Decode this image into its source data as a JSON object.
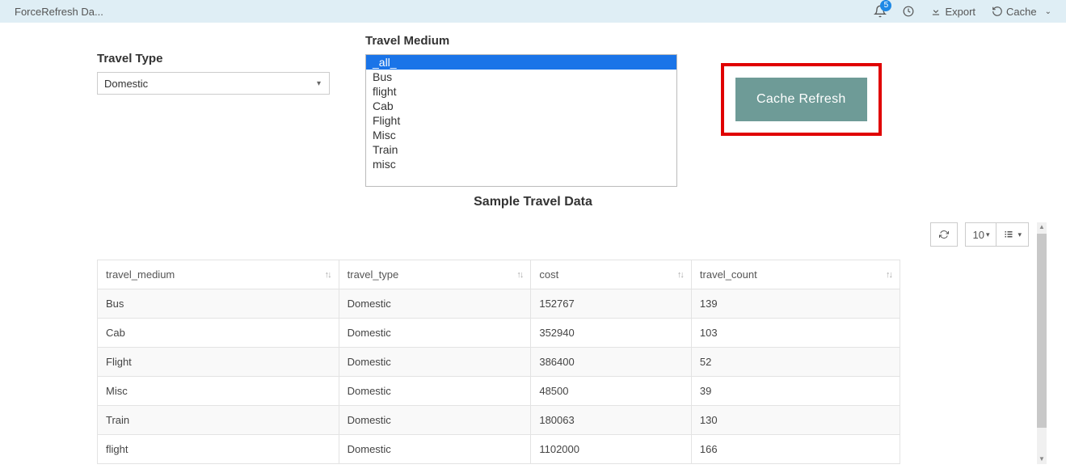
{
  "header": {
    "title": "ForceRefresh Da...",
    "badge_count": "5",
    "export_label": "Export",
    "cache_label": "Cache"
  },
  "filters": {
    "travel_type": {
      "label": "Travel Type",
      "selected": "Domestic"
    },
    "travel_medium": {
      "label": "Travel Medium",
      "options": [
        "_all_",
        "Bus",
        "flight",
        "Cab",
        "Flight",
        "Misc",
        "Train",
        "misc"
      ],
      "selected_index": 0
    }
  },
  "action": {
    "cache_refresh": "Cache Refresh"
  },
  "table": {
    "title": "Sample Travel Data",
    "page_size": "10",
    "columns": [
      "travel_medium",
      "travel_type",
      "cost",
      "travel_count"
    ],
    "rows": [
      {
        "travel_medium": "Bus",
        "travel_type": "Domestic",
        "cost": "152767",
        "travel_count": "139"
      },
      {
        "travel_medium": "Cab",
        "travel_type": "Domestic",
        "cost": "352940",
        "travel_count": "103"
      },
      {
        "travel_medium": "Flight",
        "travel_type": "Domestic",
        "cost": "386400",
        "travel_count": "52"
      },
      {
        "travel_medium": "Misc",
        "travel_type": "Domestic",
        "cost": "48500",
        "travel_count": "39"
      },
      {
        "travel_medium": "Train",
        "travel_type": "Domestic",
        "cost": "180063",
        "travel_count": "130"
      },
      {
        "travel_medium": "flight",
        "travel_type": "Domestic",
        "cost": "1102000",
        "travel_count": "166"
      }
    ]
  }
}
